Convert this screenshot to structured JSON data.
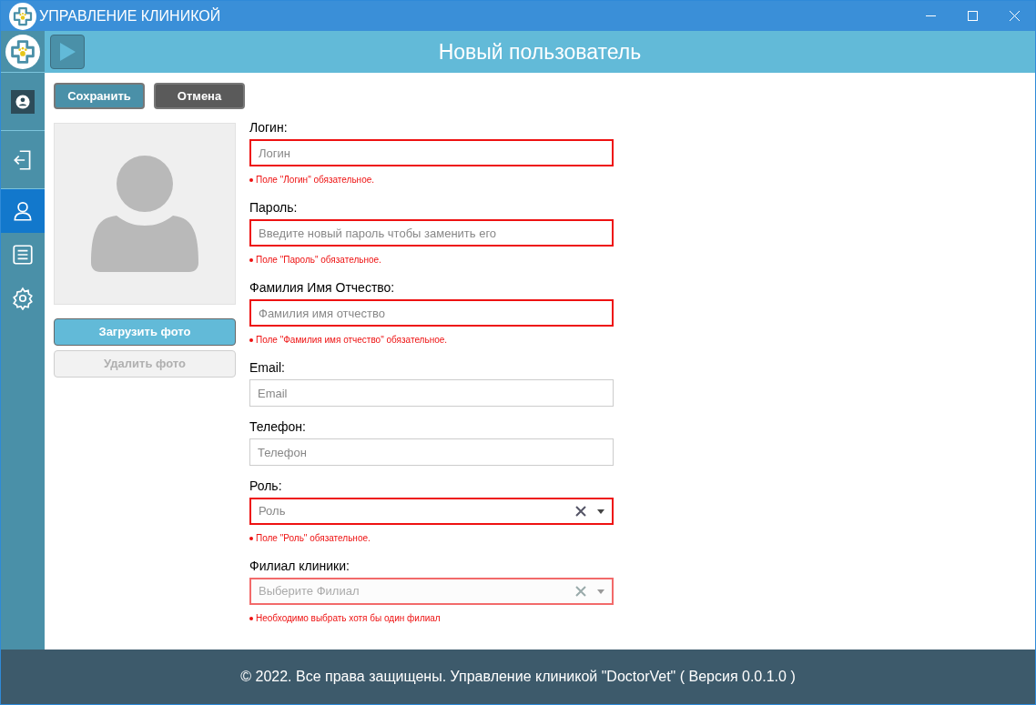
{
  "window": {
    "title": "УПРАВЛЕНИЕ КЛИНИКОЙ"
  },
  "sidebar": {
    "items": [
      {
        "kind": "clinic",
        "selected": false
      },
      {
        "kind": "logout",
        "selected": false
      },
      {
        "kind": "user",
        "selected": true
      },
      {
        "kind": "list",
        "selected": false
      },
      {
        "kind": "settings",
        "selected": false
      }
    ]
  },
  "header": {
    "title": "Новый пользователь"
  },
  "toolbar": {
    "buttons": [
      {
        "label": "Сохранить",
        "kind": "primary"
      },
      {
        "label": "Отмена",
        "kind": "dark"
      }
    ]
  },
  "photo": {
    "buttons": [
      {
        "label": "Загрузить фото",
        "disabled": false
      },
      {
        "label": "Удалить фото",
        "disabled": true
      }
    ]
  },
  "fields": [
    {
      "label": "Логин:",
      "kind": "text",
      "placeholder": "Логин",
      "invalid": true,
      "error": "Поле \"Логин\" обязательное."
    },
    {
      "label": "Пароль:",
      "kind": "text",
      "placeholder": "Введите новый пароль чтобы заменить его",
      "invalid": true,
      "error": "Поле \"Пароль\" обязательное."
    },
    {
      "label": "Фамилия Имя Отчество:",
      "kind": "text",
      "placeholder": "Фамилия имя отчество",
      "invalid": true,
      "error": "Поле \"Фамилия имя отчество\" обязательное."
    },
    {
      "label": "Email:",
      "kind": "text",
      "placeholder": "Email",
      "invalid": false
    },
    {
      "label": "Телефон:",
      "kind": "text",
      "placeholder": "Телефон",
      "invalid": false
    },
    {
      "label": "Роль:",
      "kind": "select",
      "placeholder": "Роль",
      "invalid": true,
      "disabled": false,
      "error": "Поле \"Роль\" обязательное."
    },
    {
      "label": "Филиал клиники:",
      "kind": "select",
      "placeholder": "Выберите Филиал",
      "invalid": true,
      "disabled": true,
      "error": "Необходимо выбрать хотя бы один филиал"
    }
  ],
  "footer": {
    "text": "© 2022. Все права защищены. Управление клиникой \"DoctorVet\" ( Версия 0.0.1.0 )"
  }
}
